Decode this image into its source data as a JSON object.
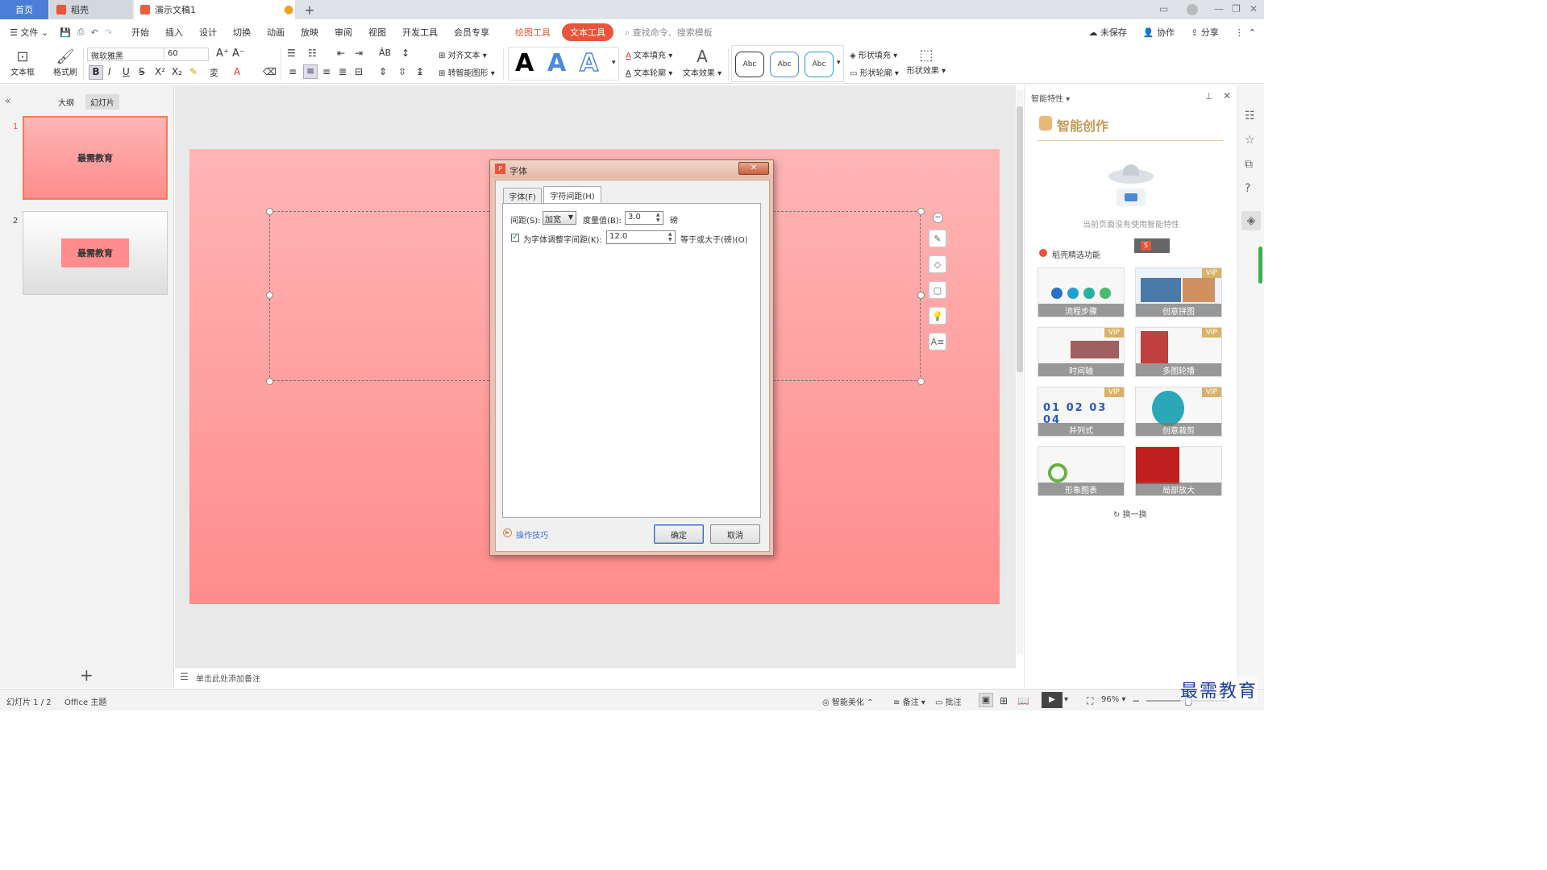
{
  "tabs": {
    "home": "首页",
    "daoke": "稻壳",
    "doc": "演示文稿1",
    "add": "+"
  },
  "menu": {
    "file": "文件",
    "items": [
      "开始",
      "插入",
      "设计",
      "切换",
      "动画",
      "放映",
      "审阅",
      "视图",
      "开发工具",
      "会员专享"
    ],
    "drawing_tools": "绘图工具",
    "text_tools": "文本工具",
    "search": "查找命令、搜索模板",
    "unsaved": "未保存",
    "collab": "协作",
    "share": "分享"
  },
  "ribbon": {
    "textbox": "文本框",
    "format_painter": "格式刷",
    "font_name": "微软雅黑",
    "font_size": "60",
    "align_text": "对齐文本",
    "smart_art": "转智能图形",
    "text_fill": "文本填充",
    "text_outline": "文本轮廓",
    "text_effect": "文本效果",
    "abc": "Abc",
    "shape_fill": "形状填充",
    "shape_outline": "形状轮廓",
    "shape_effect": "形状效果"
  },
  "left_panel": {
    "outline": "大纲",
    "slides": "幻灯片",
    "slide_nums": [
      "1",
      "2"
    ],
    "slide1_title": "最需教育",
    "slide2_title": "最需教育"
  },
  "dialog": {
    "title": "字体",
    "tab_font": "字体(F)",
    "tab_spacing": "字符间距(H)",
    "spacing_label": "间距(S):",
    "spacing_value": "加宽",
    "measure_label": "度量值(B):",
    "measure_value": "3.0",
    "measure_unit": "磅",
    "kerning_label": "为字体调整字间距(K):",
    "kerning_value": "12.0",
    "kerning_suffix": "等于或大于(磅)(O)",
    "tips": "操作技巧",
    "ok": "确定",
    "cancel": "取消"
  },
  "notes": "单击此处添加备注",
  "right_panel": {
    "header": "智能特性",
    "title": "智能创作",
    "empty_msg": "当前页面没有使用智能特性",
    "section": "稻壳精选功能",
    "vip": "VIP",
    "cards": [
      "流程步骤",
      "创意拼图",
      "时间轴",
      "多图轮播",
      "并列式",
      "创意裁剪",
      "形象图表",
      "局部放大"
    ],
    "refresh": "换一换"
  },
  "status": {
    "slide_count": "幻灯片 1 / 2",
    "theme": "Office 主题",
    "beautify": "智能美化",
    "notes": "备注",
    "comments": "批注",
    "zoom": "96%"
  },
  "watermark": "最需教育",
  "colors": {
    "accent": "#e8553b",
    "tab_blue": "#4a7ed8",
    "slide_pink": "#ff9a9a"
  }
}
